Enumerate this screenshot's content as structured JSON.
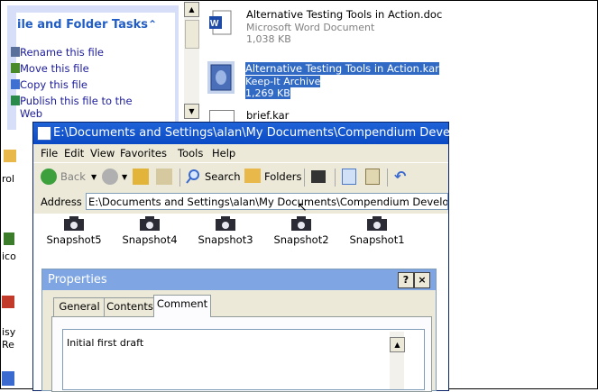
{
  "back_window": {
    "task_pane": {
      "title": "ile and Folder Tasks",
      "collapse_glyph": "»",
      "tasks": [
        {
          "label": "Rename this file",
          "icon": "rename-icon"
        },
        {
          "label": "Move this file",
          "icon": "move-icon"
        },
        {
          "label": "Copy this file",
          "icon": "copy-icon"
        },
        {
          "label": "Publish this file to the",
          "icon": "publish-icon"
        },
        {
          "label": "Web",
          "icon": ""
        }
      ]
    },
    "files": [
      {
        "name": "Alternative Testing Tools in Action.doc",
        "type": "Microsoft Word Document",
        "size": "1,038 KB"
      },
      {
        "name": "Alternative Testing Tools in Action.kar",
        "type": "Keep-It Archive",
        "size": "1,269 KB",
        "selected": true
      },
      {
        "name": "brief.kar"
      }
    ],
    "left_edge_labels": [
      "rol",
      "ico",
      "isy",
      "Re"
    ]
  },
  "explorer": {
    "title": "E:\\Documents and Settings\\alan\\My Documents\\Compendium Develo",
    "menu": [
      "File",
      "Edit",
      "View",
      "Favorites",
      "Tools",
      "Help"
    ],
    "toolbar": {
      "back": "Back",
      "search": "Search",
      "folders": "Folders"
    },
    "address_label": "Address",
    "address_value": "E:\\Documents and Settings\\alan\\My Documents\\Compendium Developm",
    "snapshots": [
      "Snapshot5",
      "Snapshot4",
      "Snapshot3",
      "Snapshot2",
      "Snapshot1"
    ]
  },
  "properties": {
    "title": "Properties",
    "help_glyph": "?",
    "close_glyph": "×",
    "tabs": [
      "General",
      "Contents",
      "Comment"
    ],
    "active_tab": "Comment",
    "comment": "Initial first draft"
  },
  "colors": {
    "titlebar": "#0a49c4",
    "selection": "#316ac5",
    "dialog_title": "#7fa6e2",
    "task_link": "#1c1c9c"
  }
}
